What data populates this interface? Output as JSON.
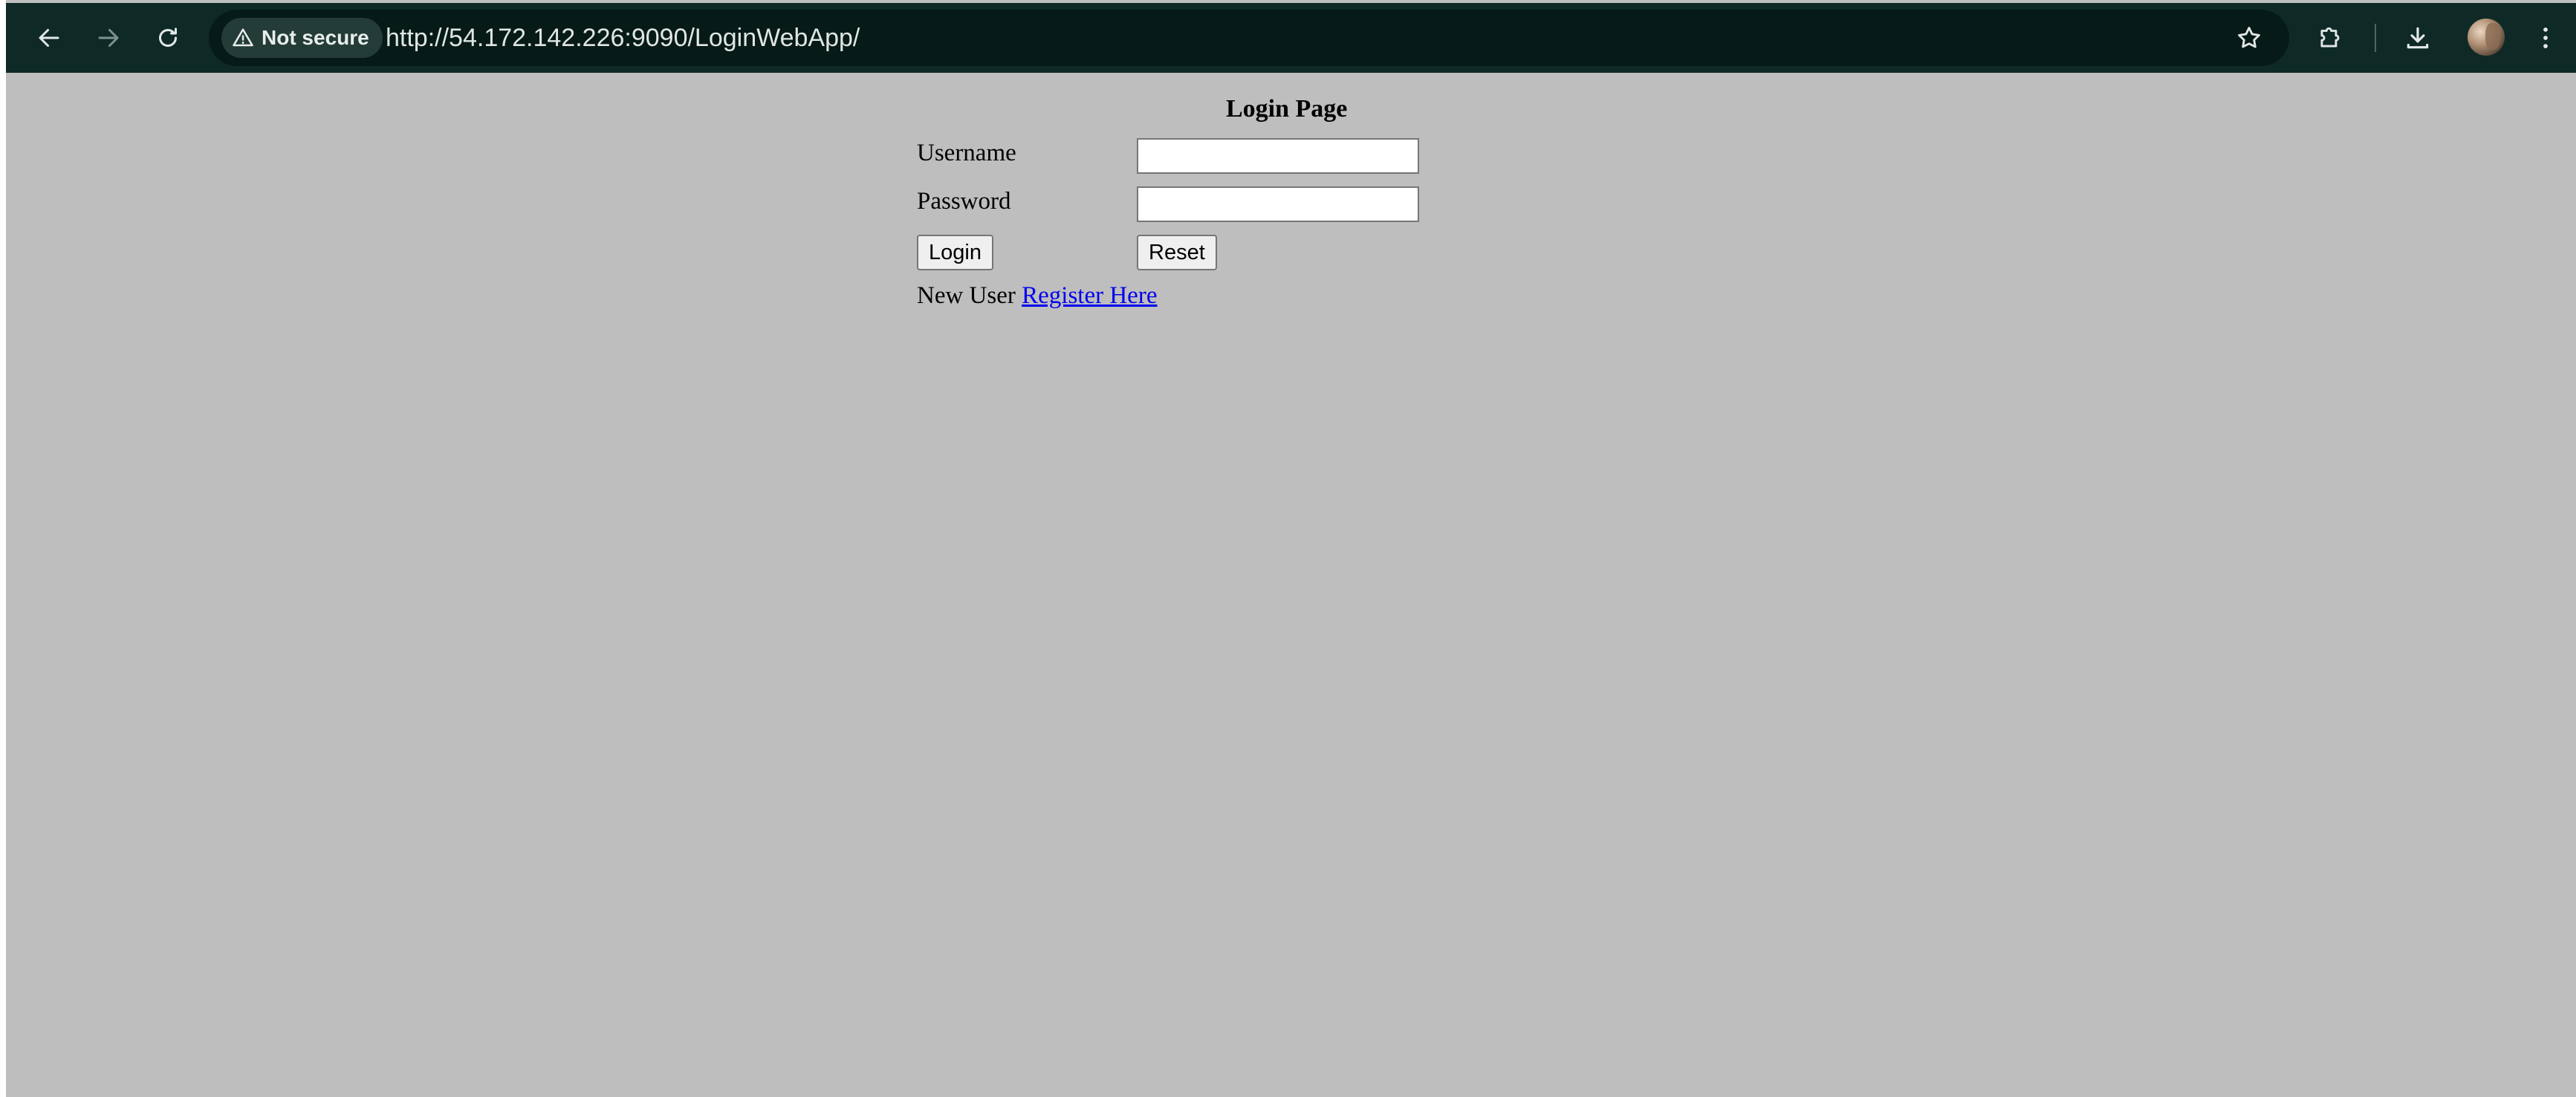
{
  "browser": {
    "security_label": "Not secure",
    "url": "http://54.172.142.226:9090/LoginWebApp/",
    "icons": {
      "back": "arrow-left-icon",
      "forward": "arrow-right-icon",
      "reload": "reload-icon",
      "security": "warning-triangle-icon",
      "bookmark": "star-icon",
      "extensions": "puzzle-icon",
      "downloads": "download-icon",
      "profile": "avatar",
      "menu": "kebab-menu-icon"
    },
    "colors": {
      "toolbar": "#0f2a26",
      "omnibox": "#061a17",
      "icon": "#e3e9e8"
    }
  },
  "page": {
    "title": "Login Page",
    "username_label": "Username",
    "password_label": "Password",
    "username_value": "",
    "password_value": "",
    "login_button": "Login",
    "reset_button": "Reset",
    "new_user_text": "New User",
    "register_link": "Register Here",
    "colors": {
      "background": "#bebebe",
      "link": "#0000ee"
    }
  }
}
